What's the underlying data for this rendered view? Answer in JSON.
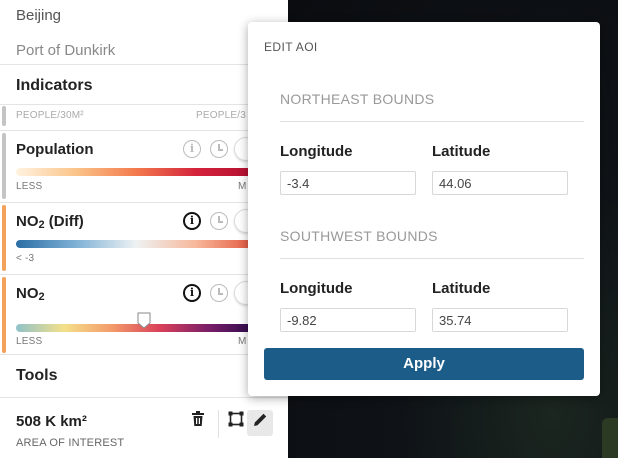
{
  "locations": [
    "Beijing",
    "Port of Dunkirk"
  ],
  "indicators_title": "Indicators",
  "top_legend": {
    "left": "PEOPLE/30M²",
    "right": "PEOPLE/3"
  },
  "layers": [
    {
      "title": "Population",
      "legend_left": "LESS",
      "legend_right": "M",
      "bar_color": "#c4c4c4",
      "info_icon": "info-icon",
      "time_icon": "clock-icon"
    },
    {
      "title_main": "NO",
      "title_sub": "2",
      "title_suffix": " (Diff)",
      "legend_left": "< -3",
      "legend_right": "",
      "bar_color": "#f2a25a",
      "info_icon": "info-icon",
      "time_icon": "clock-icon"
    },
    {
      "title_main": "NO",
      "title_sub": "2",
      "title_suffix": "",
      "legend_left": "LESS",
      "legend_right": "M",
      "bar_color": "#f2a25a",
      "info_icon": "info-icon",
      "time_icon": "clock-icon"
    }
  ],
  "tools_title": "Tools",
  "aoi": {
    "value": "508 K km²",
    "label": "AREA OF INTEREST"
  },
  "tool_icons": [
    "trash-icon",
    "draw-area-icon",
    "pencil-icon"
  ],
  "popup": {
    "title": "EDIT AOI",
    "northeast": {
      "title": "NORTHEAST BOUNDS",
      "longitude_label": "Longitude",
      "latitude_label": "Latitude",
      "longitude": "-3.4",
      "latitude": "44.06"
    },
    "southwest": {
      "title": "SOUTHWEST BOUNDS",
      "longitude_label": "Longitude",
      "latitude_label": "Latitude",
      "longitude": "-9.82",
      "latitude": "35.74"
    },
    "apply_label": "Apply"
  },
  "colors": {
    "apply_button": "#1b5c88",
    "accent_bar": "#f2a25a"
  }
}
